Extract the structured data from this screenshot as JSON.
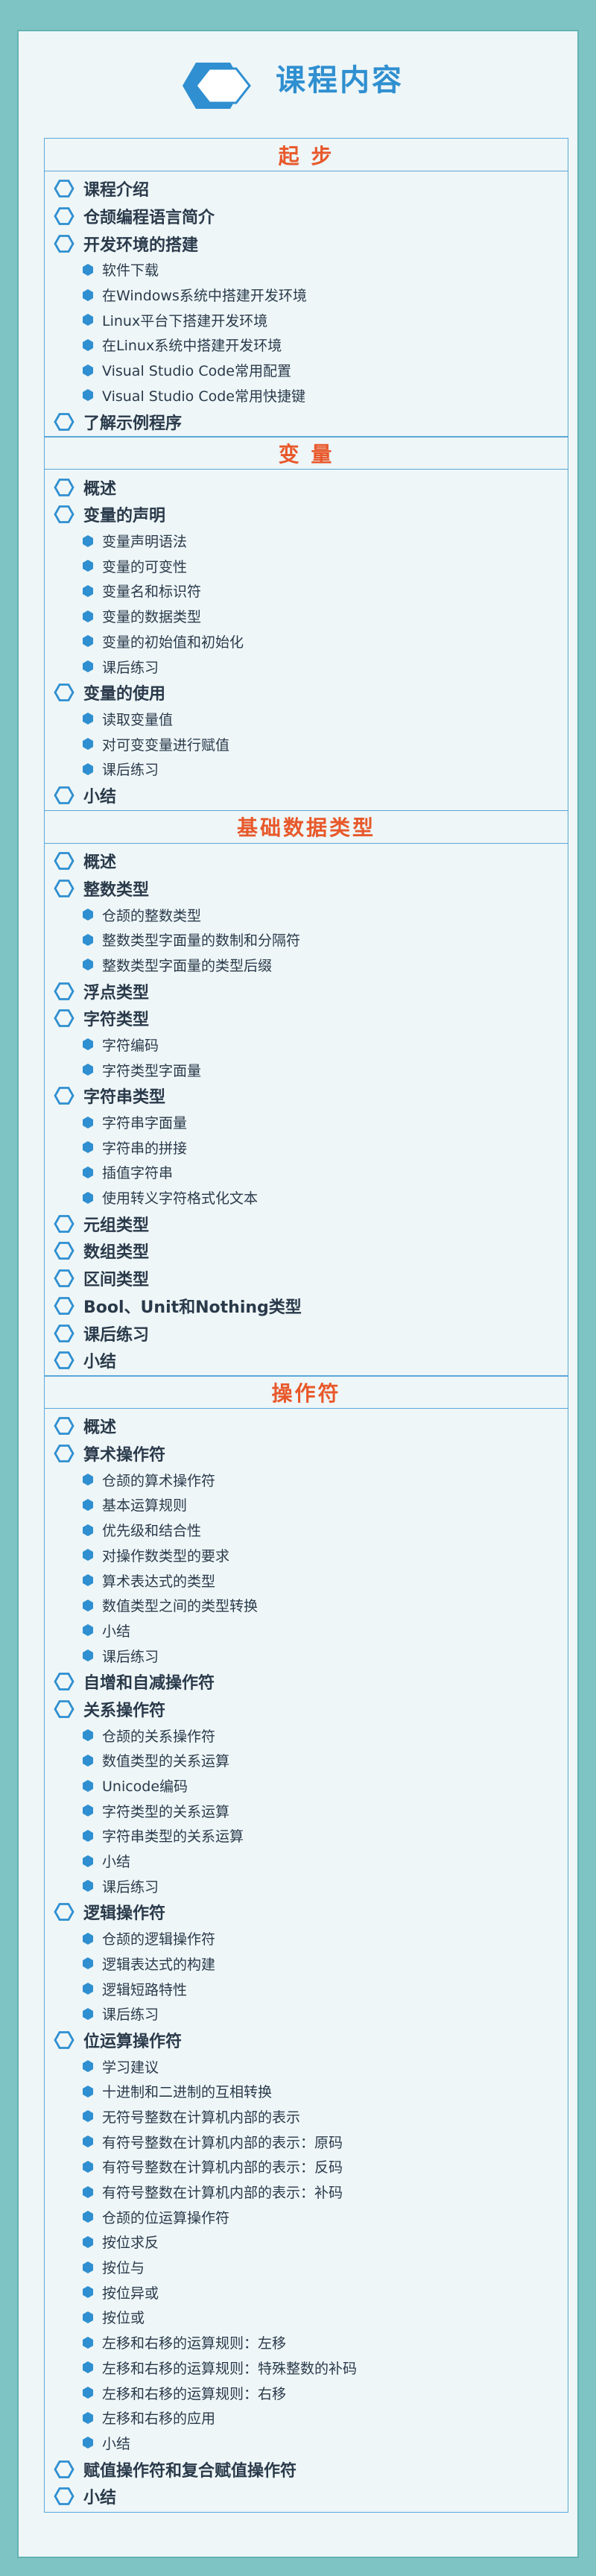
{
  "page_title": "课程内容",
  "colors": {
    "accent": "#2f8fd0",
    "section_heading": "#e8582a",
    "background": "#7fc4c4",
    "card": "#eef6f8"
  },
  "sections": [
    {
      "heading": "起 步",
      "items": [
        {
          "label": "课程介绍",
          "children": []
        },
        {
          "label": "仓颉编程语言简介",
          "children": []
        },
        {
          "label": "开发环境的搭建",
          "children": [
            "软件下载",
            "在Windows系统中搭建开发环境",
            "Linux平台下搭建开发环境",
            "在Linux系统中搭建开发环境",
            "Visual Studio Code常用配置",
            "Visual Studio Code常用快捷键"
          ]
        },
        {
          "label": "了解示例程序",
          "children": []
        }
      ]
    },
    {
      "heading": "变 量",
      "items": [
        {
          "label": "概述",
          "children": []
        },
        {
          "label": "变量的声明",
          "children": [
            "变量声明语法",
            "变量的可变性",
            "变量名和标识符",
            "变量的数据类型",
            "变量的初始值和初始化",
            "课后练习"
          ]
        },
        {
          "label": "变量的使用",
          "children": [
            "读取变量值",
            "对可变变量进行赋值",
            "课后练习"
          ]
        },
        {
          "label": "小结",
          "children": []
        }
      ]
    },
    {
      "heading": "基础数据类型",
      "items": [
        {
          "label": "概述",
          "children": []
        },
        {
          "label": "整数类型",
          "children": [
            "仓颉的整数类型",
            "整数类型字面量的数制和分隔符",
            "整数类型字面量的类型后缀"
          ]
        },
        {
          "label": "浮点类型",
          "children": []
        },
        {
          "label": "字符类型",
          "children": [
            "字符编码",
            "字符类型字面量"
          ]
        },
        {
          "label": "字符串类型",
          "children": [
            "字符串字面量",
            "字符串的拼接",
            "插值字符串",
            "使用转义字符格式化文本"
          ]
        },
        {
          "label": "元组类型",
          "children": []
        },
        {
          "label": "数组类型",
          "children": []
        },
        {
          "label": "区间类型",
          "children": []
        },
        {
          "label": "Bool、Unit和Nothing类型",
          "children": []
        },
        {
          "label": "课后练习",
          "children": []
        },
        {
          "label": "小结",
          "children": []
        }
      ]
    },
    {
      "heading": "操作符",
      "items": [
        {
          "label": "概述",
          "children": []
        },
        {
          "label": "算术操作符",
          "children": [
            "仓颉的算术操作符",
            "基本运算规则",
            "优先级和结合性",
            "对操作数类型的要求",
            "算术表达式的类型",
            "数值类型之间的类型转换",
            "小结",
            "课后练习"
          ]
        },
        {
          "label": "自增和自减操作符",
          "children": []
        },
        {
          "label": "关系操作符",
          "children": [
            "仓颉的关系操作符",
            "数值类型的关系运算",
            "Unicode编码",
            "字符类型的关系运算",
            "字符串类型的关系运算",
            "小结",
            "课后练习"
          ]
        },
        {
          "label": "逻辑操作符",
          "children": [
            "仓颉的逻辑操作符",
            "逻辑表达式的构建",
            "逻辑短路特性",
            "课后练习"
          ]
        },
        {
          "label": "位运算操作符",
          "children": [
            "学习建议",
            "十进制和二进制的互相转换",
            "无符号整数在计算机内部的表示",
            "有符号整数在计算机内部的表示：原码",
            "有符号整数在计算机内部的表示：反码",
            "有符号整数在计算机内部的表示：补码",
            "仓颉的位运算操作符",
            "按位求反",
            "按位与",
            "按位异或",
            "按位或",
            "左移和右移的运算规则：左移",
            "左移和右移的运算规则：特殊整数的补码",
            "左移和右移的运算规则：右移",
            "左移和右移的应用",
            "小结"
          ]
        },
        {
          "label": "赋值操作符和复合赋值操作符",
          "children": []
        },
        {
          "label": "小结",
          "children": []
        }
      ]
    }
  ]
}
